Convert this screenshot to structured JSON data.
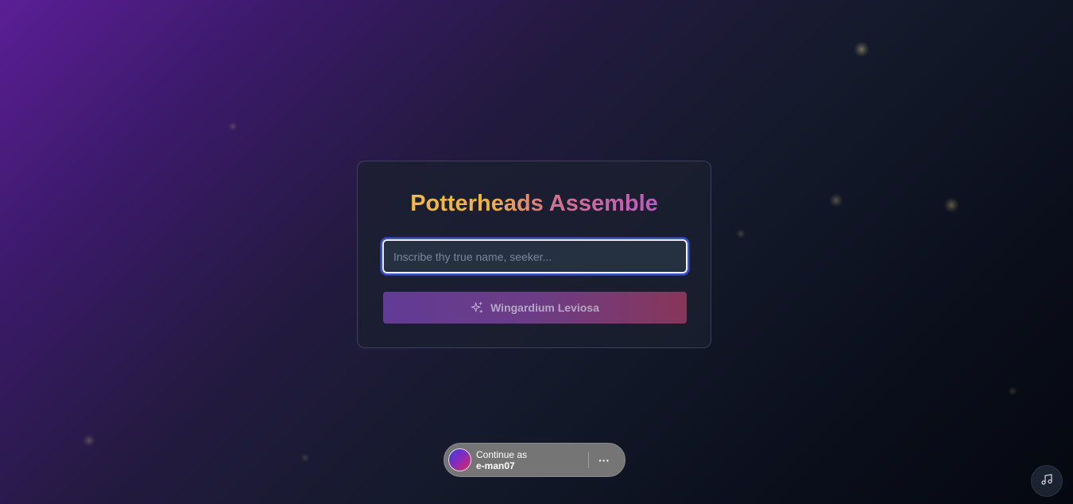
{
  "login": {
    "title": "Potterheads Assemble",
    "name_placeholder": "Inscribe thy true name, seeker...",
    "name_value": "",
    "submit_label": "Wingardium Leviosa",
    "submit_icon": "sparkles-icon"
  },
  "account_prompt": {
    "line1": "Continue as",
    "username": "e-man07",
    "more_label": "···",
    "avatar_icon": "avatar"
  },
  "music_toggle": {
    "icon": "music-note-icon"
  },
  "colors": {
    "title_gold": "#f4c43a",
    "title_purple": "#b34ed6",
    "button_start": "#623b95",
    "button_end": "#883659",
    "focus_ring": "#3a53d8"
  }
}
